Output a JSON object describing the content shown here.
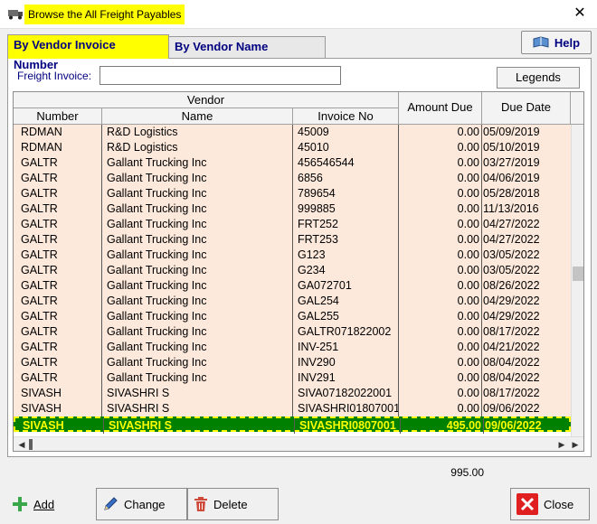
{
  "window": {
    "title": "Browse the All Freight Payables",
    "close_glyph": "✕"
  },
  "tabs": [
    {
      "label": "By Vendor Invoice Number",
      "active": true
    },
    {
      "label": "By Vendor Name",
      "active": false
    }
  ],
  "help": {
    "label": "Help",
    "icon": "book-icon"
  },
  "search": {
    "label": "Freight Invoice:",
    "value": "",
    "placeholder": ""
  },
  "legends": {
    "label": "Legends"
  },
  "grid": {
    "group_header": "Vendor",
    "columns": {
      "number": "Number",
      "name": "Name",
      "invoice": "Invoice No",
      "amount": "Amount Due",
      "date": "Due Date"
    },
    "rows": [
      {
        "number": "RDMAN",
        "name": "R&D Logistics",
        "invoice": "45009",
        "amount": "0.00",
        "date": "05/09/2019"
      },
      {
        "number": "RDMAN",
        "name": "R&D Logistics",
        "invoice": "45010",
        "amount": "0.00",
        "date": "05/10/2019"
      },
      {
        "number": "GALTR",
        "name": "Gallant Trucking Inc",
        "invoice": "456546544",
        "amount": "0.00",
        "date": "03/27/2019"
      },
      {
        "number": "GALTR",
        "name": "Gallant Trucking Inc",
        "invoice": "6856",
        "amount": "0.00",
        "date": "04/06/2019"
      },
      {
        "number": "GALTR",
        "name": "Gallant Trucking Inc",
        "invoice": "789654",
        "amount": "0.00",
        "date": "05/28/2018"
      },
      {
        "number": "GALTR",
        "name": "Gallant Trucking Inc",
        "invoice": "999885",
        "amount": "0.00",
        "date": "11/13/2016"
      },
      {
        "number": "GALTR",
        "name": "Gallant Trucking Inc",
        "invoice": "FRT252",
        "amount": "0.00",
        "date": "04/27/2022"
      },
      {
        "number": "GALTR",
        "name": "Gallant Trucking Inc",
        "invoice": "FRT253",
        "amount": "0.00",
        "date": "04/27/2022"
      },
      {
        "number": "GALTR",
        "name": "Gallant Trucking Inc",
        "invoice": "G123",
        "amount": "0.00",
        "date": "03/05/2022"
      },
      {
        "number": "GALTR",
        "name": "Gallant Trucking Inc",
        "invoice": "G234",
        "amount": "0.00",
        "date": "03/05/2022"
      },
      {
        "number": "GALTR",
        "name": "Gallant Trucking Inc",
        "invoice": "GA072701",
        "amount": "0.00",
        "date": "08/26/2022"
      },
      {
        "number": "GALTR",
        "name": "Gallant Trucking Inc",
        "invoice": "GAL254",
        "amount": "0.00",
        "date": "04/29/2022"
      },
      {
        "number": "GALTR",
        "name": "Gallant Trucking Inc",
        "invoice": "GAL255",
        "amount": "0.00",
        "date": "04/29/2022"
      },
      {
        "number": "GALTR",
        "name": "Gallant Trucking Inc",
        "invoice": "GALTR071822002",
        "amount": "0.00",
        "date": "08/17/2022"
      },
      {
        "number": "GALTR",
        "name": "Gallant Trucking Inc",
        "invoice": "INV-251",
        "amount": "0.00",
        "date": "04/21/2022"
      },
      {
        "number": "GALTR",
        "name": "Gallant Trucking Inc",
        "invoice": "INV290",
        "amount": "0.00",
        "date": "08/04/2022"
      },
      {
        "number": "GALTR",
        "name": "Gallant Trucking Inc",
        "invoice": "INV291",
        "amount": "0.00",
        "date": "08/04/2022"
      },
      {
        "number": "SIVASH",
        "name": "SIVASHRI S",
        "invoice": "SIVA07182022001",
        "amount": "0.00",
        "date": "08/17/2022"
      },
      {
        "number": "SIVASH",
        "name": "SIVASHRI S",
        "invoice": "SIVASHRI01807001",
        "amount": "0.00",
        "date": "09/06/2022"
      },
      {
        "number": "SIVASH",
        "name": "SIVASHRI S",
        "invoice": "SIVASHRI0807001",
        "amount": "495.00",
        "date": "09/06/2022",
        "selected": true
      }
    ]
  },
  "total": "995.00",
  "buttons": {
    "add": {
      "label": "Add",
      "icon": "plus-icon"
    },
    "change": {
      "label": "Change",
      "icon": "pencil-icon"
    },
    "delete": {
      "label": "Delete",
      "icon": "trash-icon"
    },
    "close": {
      "label": "Close",
      "icon": "close-icon"
    }
  },
  "colors": {
    "row_bg": "#fde9dc",
    "selected_bg": "#008000",
    "selected_text": "#ffff00",
    "tab_active": "#ffff00",
    "title_accent": "#000080"
  }
}
